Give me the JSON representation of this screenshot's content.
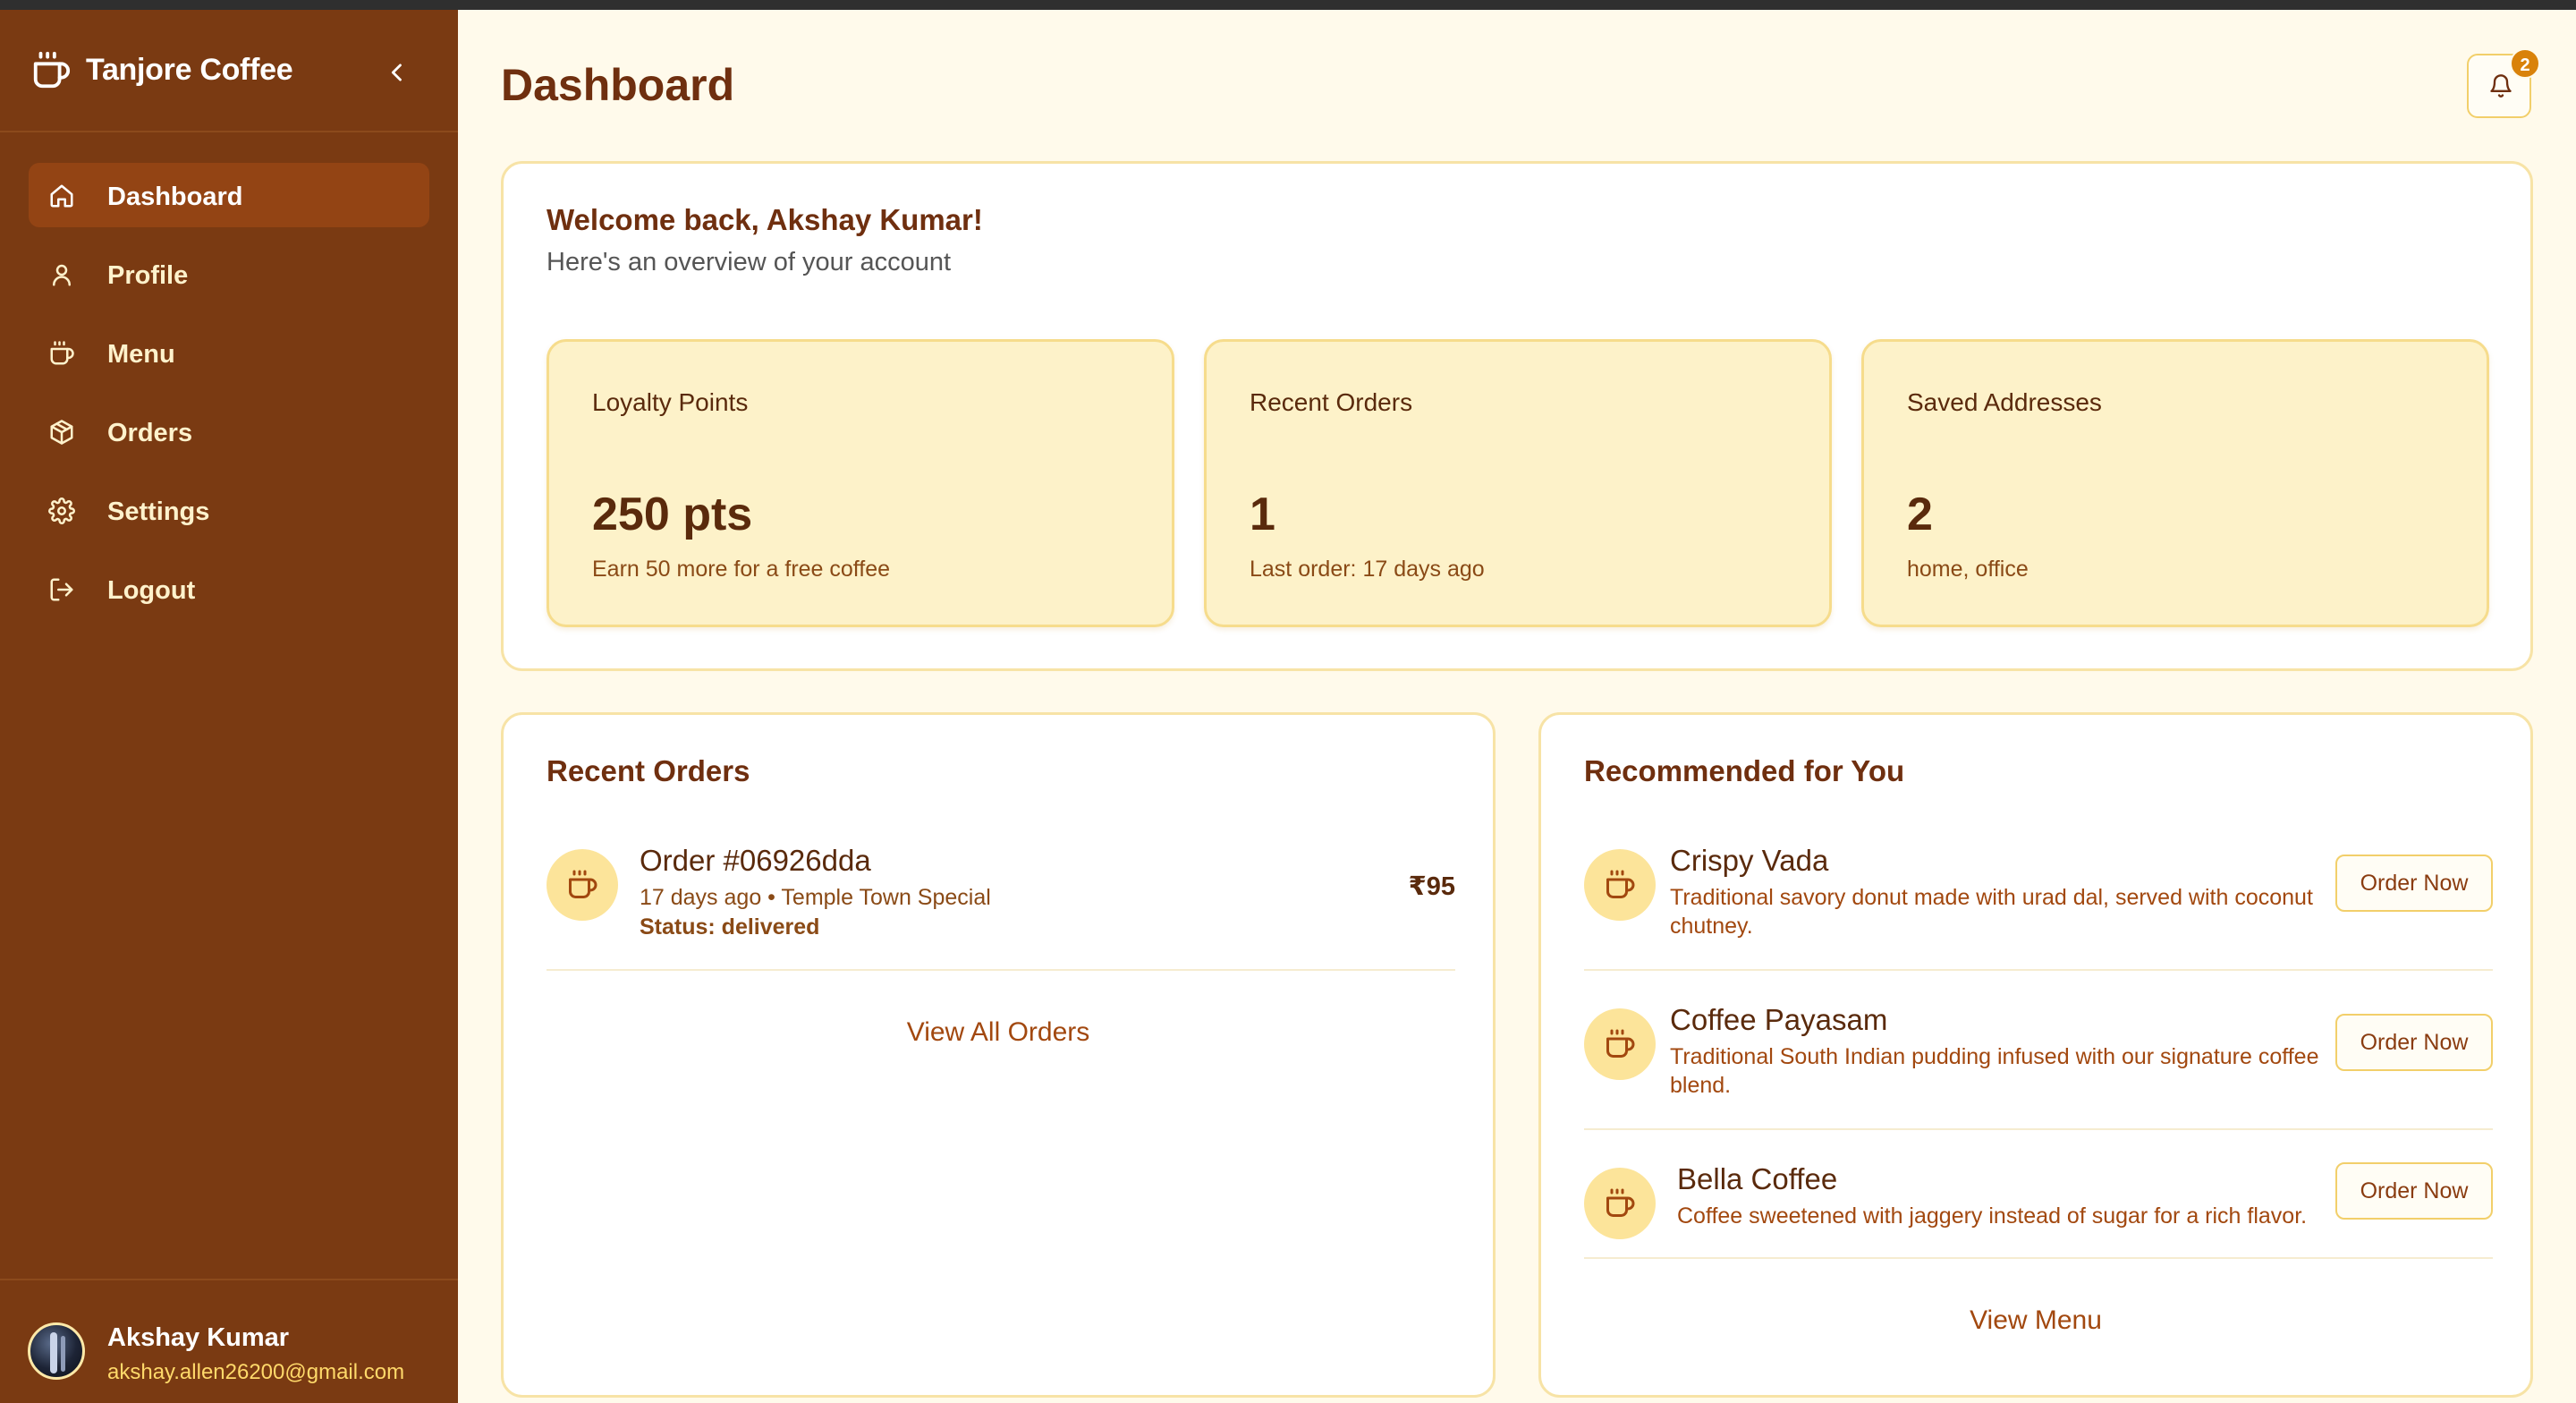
{
  "app": {
    "name": "Tanjore Coffee"
  },
  "sidebar": {
    "items": [
      {
        "label": "Dashboard",
        "icon": "home-icon",
        "active": true
      },
      {
        "label": "Profile",
        "icon": "user-icon",
        "active": false
      },
      {
        "label": "Menu",
        "icon": "coffee-icon",
        "active": false
      },
      {
        "label": "Orders",
        "icon": "package-icon",
        "active": false
      },
      {
        "label": "Settings",
        "icon": "gear-icon",
        "active": false
      },
      {
        "label": "Logout",
        "icon": "logout-icon",
        "active": false
      }
    ],
    "user": {
      "name": "Akshay Kumar",
      "email": "akshay.allen26200@gmail.com"
    }
  },
  "header": {
    "title": "Dashboard",
    "notification_count": "2"
  },
  "welcome": {
    "title": "Welcome back, Akshay Kumar!",
    "subtitle": "Here's an overview of your account",
    "stats": [
      {
        "label": "Loyalty Points",
        "value": "250 pts",
        "note": "Earn 50 more for a free coffee"
      },
      {
        "label": "Recent Orders",
        "value": "1",
        "note": "Last order: 17 days ago"
      },
      {
        "label": "Saved Addresses",
        "value": "2",
        "note": "home, office"
      }
    ]
  },
  "recent_orders": {
    "title": "Recent Orders",
    "orders": [
      {
        "title": "Order #06926dda",
        "meta": "17 days ago • Temple Town Special",
        "status": "Status: delivered",
        "price": "₹95"
      }
    ],
    "view_all_label": "View All Orders"
  },
  "recommended": {
    "title": "Recommended for You",
    "items": [
      {
        "name": "Crispy Vada",
        "description": "Traditional savory donut made with urad dal, served with coconut chutney.",
        "button": "Order Now"
      },
      {
        "name": "Coffee Payasam",
        "description": "Traditional South Indian pudding infused with our signature coffee blend.",
        "button": "Order Now"
      },
      {
        "name": "Bella Coffee",
        "description": "Coffee sweetened with jaggery instead of sugar for a rich flavor.",
        "button": "Order Now"
      }
    ],
    "view_menu_label": "View Menu"
  },
  "colors": {
    "sidebar_bg": "#7a3a12",
    "active_item_bg": "#934414",
    "page_bg": "#fffaeb",
    "stat_card_bg": "#fdf2c9",
    "accent": "#d9820a",
    "title_text": "#6f2f0f"
  }
}
